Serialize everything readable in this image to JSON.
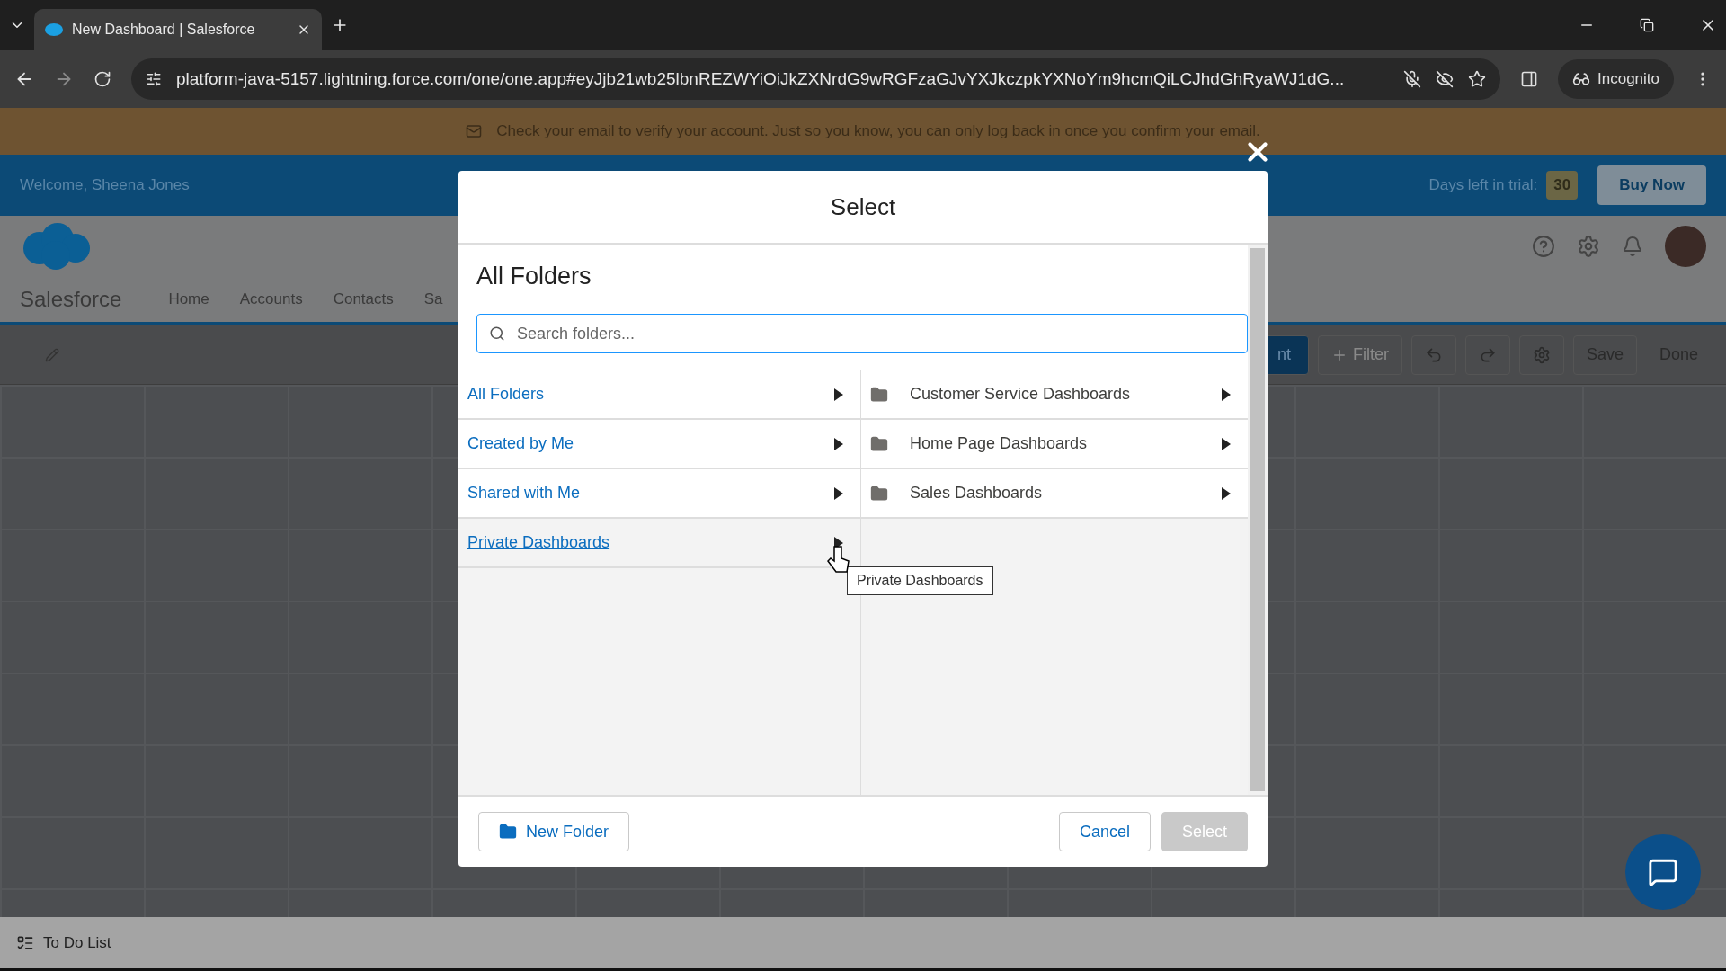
{
  "browser": {
    "tabs": [
      {
        "title": "New Dashboard | Salesforce",
        "selected": true
      }
    ],
    "url": "platform-java-5157.lightning.force.com/one/one.app#eyJjb21wb25lbnREZWYiOiJkZXNrdG9wRGFzaGJvYXJkczpkYXNoYm9hcmQiLCJhdGhRyaWJ1dG...",
    "profile": "Incognito"
  },
  "banner": {
    "text": "Check your email to verify your account. Just so you know, you can only log back in once you confirm your email."
  },
  "trial_bar": {
    "welcome": "Welcome, Sheena Jones",
    "days_label": "Days left in trial:",
    "days": "30",
    "buy": "Buy Now"
  },
  "app": {
    "name": "Salesforce",
    "nav": [
      "Home",
      "Accounts",
      "Contacts",
      "Sa"
    ],
    "toolbar": [
      {
        "kind": "primary",
        "label": "nt"
      },
      {
        "kind": "add",
        "label": "Filter"
      },
      {
        "kind": "undo"
      },
      {
        "kind": "redo"
      },
      {
        "kind": "gear"
      },
      {
        "kind": "text",
        "label": "Save"
      },
      {
        "kind": "plain",
        "label": "Done"
      }
    ]
  },
  "modal": {
    "title": "Select",
    "heading": "All Folders",
    "search": {
      "placeholder": "Search folders..."
    },
    "left_items": [
      {
        "label": "All Folders",
        "hovered": false
      },
      {
        "label": "Created by Me",
        "hovered": false
      },
      {
        "label": "Shared with Me",
        "hovered": false
      },
      {
        "label": "Private Dashboards",
        "hovered": true
      }
    ],
    "right_items": [
      {
        "label": "Customer Service Dashboards"
      },
      {
        "label": "Home Page Dashboards"
      },
      {
        "label": "Sales Dashboards"
      }
    ],
    "tooltip": "Private Dashboards",
    "new_folder": "New Folder",
    "cancel": "Cancel",
    "select": {
      "label": "Select",
      "disabled": true
    }
  },
  "footer": {
    "label": "To Do List"
  }
}
